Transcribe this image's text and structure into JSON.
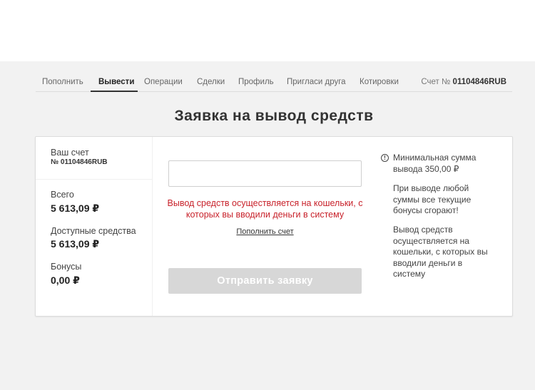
{
  "nav": {
    "items": [
      {
        "label": "Пополнить",
        "active": false
      },
      {
        "label": "Вывести",
        "active": true
      },
      {
        "label": "Операции",
        "active": false
      },
      {
        "label": "Сделки",
        "active": false
      },
      {
        "label": "Профиль",
        "active": false
      },
      {
        "label": "Пригласи друга",
        "active": false
      },
      {
        "label": "Котировки",
        "active": false
      }
    ],
    "account_prefix": "Счет №",
    "account_number": "01104846RUB"
  },
  "page_title": "Заявка на вывод средств",
  "summary": {
    "account_label": "Ваш счет",
    "account_number": "№ 01104846RUB",
    "total_label": "Всего",
    "total_value": "5 613,09 ₽",
    "available_label": "Доступные средства",
    "available_value": "5 613,09 ₽",
    "bonus_label": "Бонусы",
    "bonus_value": "0,00 ₽"
  },
  "form": {
    "amount_value": "",
    "warning": "Вывод средств осуществляется на кошельки, с которых вы вводили деньги в систему",
    "topup_link": "Пополнить счет",
    "submit_label": "Отправить заявку",
    "submit_disabled": true
  },
  "info": {
    "icon": "info-icon",
    "min_amount": "Минимальная сумма вывода 350,00 ₽",
    "bonus_note": "При выводе любой суммы все текущие бонусы сгорают!",
    "wallet_note": "Вывод средств осуществляется на кошельки, с которых вы вводили деньги в систему"
  },
  "colors": {
    "warning": "#c8222b",
    "button_disabled": "#d7d7d7",
    "background": "#f2f2f2"
  }
}
